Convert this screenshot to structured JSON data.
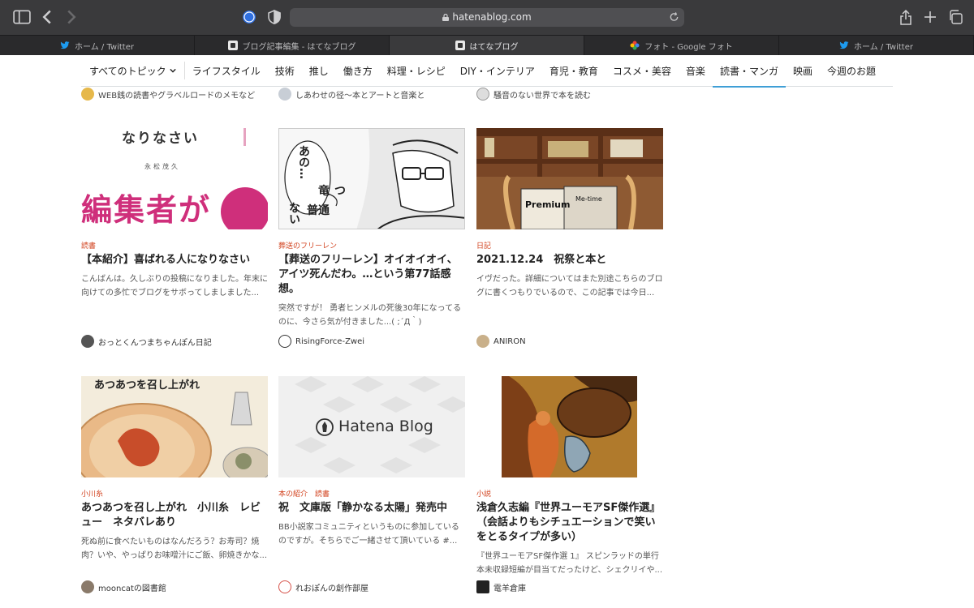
{
  "browser": {
    "url": "hatenablog.com",
    "tabs": [
      {
        "label": "ホーム / Twitter",
        "icon": "twitter-icon"
      },
      {
        "label": "ブログ記事編集 - はてなブログ",
        "icon": "hatena-icon"
      },
      {
        "label": "はてなブログ",
        "icon": "hatena-icon",
        "active": true
      },
      {
        "label": "フォト - Google フォト",
        "icon": "google-photos-icon"
      },
      {
        "label": "ホーム / Twitter",
        "icon": "twitter-icon"
      }
    ]
  },
  "nav": {
    "all_topics": "すべてのトピック",
    "items": [
      "ライフスタイル",
      "技術",
      "推し",
      "働き方",
      "料理・レシピ",
      "DIY・インテリア",
      "育児・教育",
      "コスメ・美容",
      "音楽",
      "読書・マンガ",
      "映画",
      "今週のお題"
    ],
    "active": "読書・マンガ"
  },
  "top_authors": [
    "WEB銭の読書やグラベルロードのメモなど",
    "しあわせの径〜本とアートと音楽と",
    "騒音のない世界で本を読む"
  ],
  "cards": [
    {
      "category": "読書",
      "title": "【本紹介】喜ばれる人になりなさい",
      "excerpt": "こんばんは。久しぶりの投稿になりました。年末に向けての多忙でブログをサボってしましました...",
      "author": "おっとくんつまちゃんぽん日記",
      "thumb_text": {
        "top": "なりなさい",
        "name": "永松茂久",
        "big": "編集者が"
      }
    },
    {
      "category": "葬送のフリーレン",
      "title": "【葬送のフリーレン】オイオイオイ、アイツ死んだわ。…という第77話感想。",
      "excerpt": "突然ですが！ 勇者ヒンメルの死後30年になってるのに、今さら気が付きました...( ;´Д｀)",
      "author": "RisingForce-Zwei",
      "thumb_text": {
        "a": "あの…",
        "b": "竜",
        "c": "つ",
        "d": "普通",
        "e": "ない"
      }
    },
    {
      "category": "日記",
      "title": "2021.12.24　祝祭と本と",
      "excerpt": "イヴだった。詳細についてはまた別途こちらのブログに書くつもりでいるので、この記事では今日...",
      "author": "ANIRON",
      "thumb_text": {
        "mag1": "Premium",
        "mag2": "Me-time"
      }
    },
    {
      "category": "小川糸",
      "title": "あつあつを召し上がれ　小川糸　レビュー　ネタバレあり",
      "excerpt": "死ぬ前に食べたいものはなんだろう？お寿司？焼肉？いや、やっぱりお味噌汁にご飯、卵焼きかな...",
      "author": "mooncatの図書館",
      "thumb_text": {
        "top": "あつあつを召し上がれ"
      }
    },
    {
      "category": "本の紹介　読書",
      "title": "祝　文庫版「静かなる太陽」発売中",
      "excerpt": "BB小説家コミュニティというものに参加しているのですが。そちらでご一緒させて頂いている #...",
      "author": "れおぽんの創作部屋",
      "thumb_text": {
        "logo": "Hatena Blog"
      }
    },
    {
      "category": "小説",
      "title": "浅倉久志編『世界ユーモアSF傑作選』（会話よりもシチュエーションで笑いをとるタイプが多い）",
      "excerpt": "『世界ユーモアSF傑作選 1』 スピンラッドの単行本未収録短編が目当てだったけど、シェクリイや...",
      "author": "電羊倉庫",
      "thumb_text": {}
    }
  ]
}
